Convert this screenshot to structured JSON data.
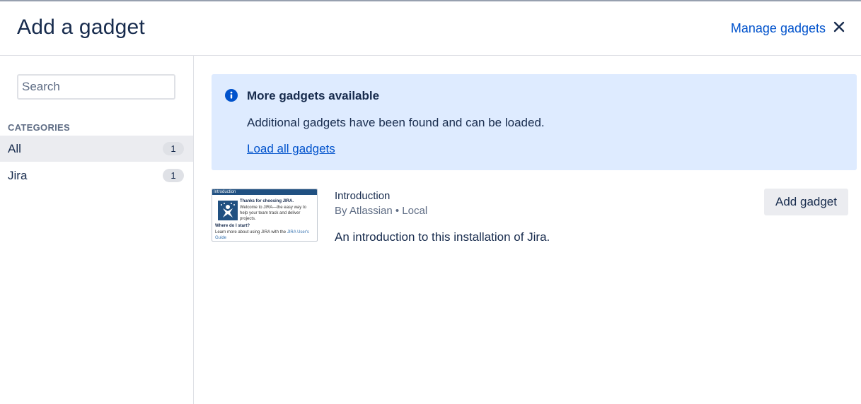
{
  "dialog": {
    "title": "Add a gadget",
    "manage_link": "Manage gadgets",
    "close_icon": "close-icon"
  },
  "sidebar": {
    "search": {
      "placeholder": "Search",
      "value": ""
    },
    "categories_heading": "CATEGORIES",
    "categories": [
      {
        "label": "All",
        "count": "1",
        "selected": true
      },
      {
        "label": "Jira",
        "count": "1",
        "selected": false
      }
    ]
  },
  "banner": {
    "icon": "info-icon",
    "title": "More gadgets available",
    "text": "Additional gadgets have been found and can be loaded.",
    "link": "Load all gadgets"
  },
  "gadgets": [
    {
      "name": "Introduction",
      "meta": "By Atlassian • Local",
      "description": "An introduction to this installation of Jira.",
      "add_label": "Add gadget",
      "thumbnail": {
        "bar_title": "Introduction",
        "heading": "Thanks for choosing JIRA.",
        "text": "Welcome to JIRA—the easy way to help your team track and deliver projects.",
        "subheading": "Where do I start?",
        "sub_text": "Learn more about using JIRA with the",
        "sub_link": "JIRA User's Guide"
      }
    }
  ],
  "colors": {
    "brand_blue": "#0052cc",
    "banner_bg": "#deebff",
    "text": "#172b4d",
    "subtle_text": "#5e6c84",
    "selected_bg": "#ebecf0"
  }
}
